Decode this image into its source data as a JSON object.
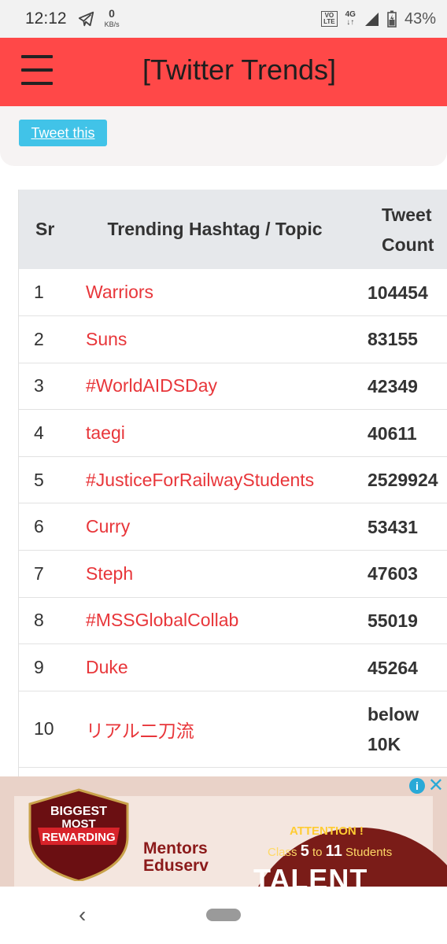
{
  "status_bar": {
    "time": "12:12",
    "net_speed_value": "0",
    "net_speed_unit": "KB/s",
    "volte_line1": "VO",
    "volte_line2": "LTE",
    "network": "4G",
    "battery": "43%",
    "icons": [
      "telegram-icon",
      "signal-icon",
      "battery-icon"
    ]
  },
  "app_bar": {
    "title": "[Twitter Trends]",
    "color": "#ff4848"
  },
  "tweet_button": {
    "label": "Tweet this",
    "color": "#41c3e8"
  },
  "table": {
    "headers": {
      "sr": "Sr",
      "topic": "Trending Hashtag / Topic",
      "count_line1": "Tweet",
      "count_line2": "Count"
    },
    "link_color": "#e8363a",
    "rows": [
      {
        "sr": "1",
        "topic": "Warriors",
        "count": "104454"
      },
      {
        "sr": "2",
        "topic": "Suns",
        "count": "83155"
      },
      {
        "sr": "3",
        "topic": "#WorldAIDSDay",
        "count": "42349"
      },
      {
        "sr": "4",
        "topic": "taegi",
        "count": "40611"
      },
      {
        "sr": "5",
        "topic": "#JusticeForRailwayStudents",
        "count": "2529924"
      },
      {
        "sr": "6",
        "topic": "Curry",
        "count": "53431"
      },
      {
        "sr": "7",
        "topic": "Steph",
        "count": "47603"
      },
      {
        "sr": "8",
        "topic": "#MSSGlobalCollab",
        "count": "55019"
      },
      {
        "sr": "9",
        "topic": "Duke",
        "count": "45264"
      },
      {
        "sr": "10",
        "topic": "リアル二刀流",
        "count_line1": "below",
        "count_line2": "10K"
      }
    ]
  },
  "ad": {
    "badge_line1": "BIGGEST",
    "badge_line2": "MOST",
    "badge_line3": "REWARDING",
    "brand_line1": "Mentors",
    "brand_line2": "Eduserv",
    "attention": "ATTENTION !",
    "class_prefix": "Class",
    "class_from": "5",
    "class_to_word": "to",
    "class_to": "11",
    "class_suffix": "Students",
    "headline": "TALENT"
  },
  "nav": {
    "back_icon": "chevron-left-icon",
    "home_icon": "home-pill-icon"
  }
}
